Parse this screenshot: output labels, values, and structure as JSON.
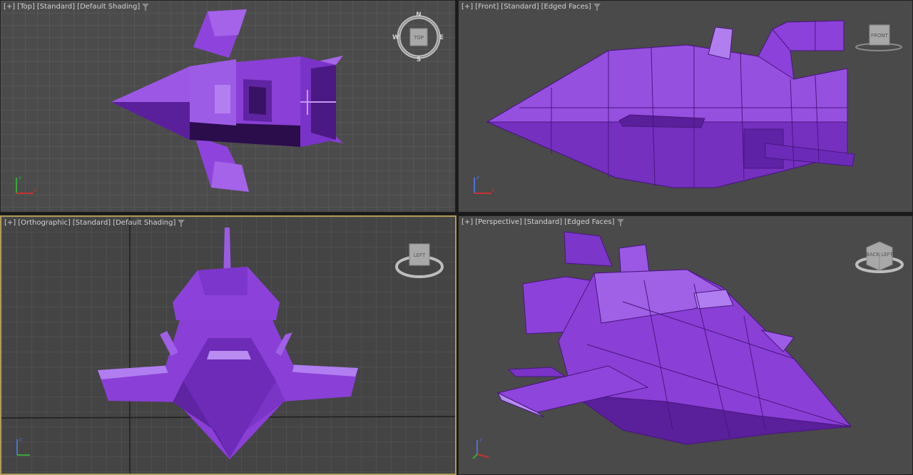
{
  "viewports": {
    "top": {
      "plus": "[+]",
      "view": "[Top]",
      "shading_mode": "[Standard]",
      "display": "[Default Shading]",
      "viewcube_face": "TOP",
      "compass": {
        "n": "N",
        "s": "S",
        "e": "E",
        "w": "W"
      }
    },
    "front": {
      "plus": "[+]",
      "view": "[Front]",
      "shading_mode": "[Standard]",
      "display": "[Edged Faces]",
      "viewcube_face": "FRONT"
    },
    "orthographic": {
      "plus": "[+]",
      "view": "[Orthographic]",
      "shading_mode": "[Standard]",
      "display": "[Default Shading]",
      "viewcube_face": "LEFT",
      "active": true
    },
    "perspective": {
      "plus": "[+]",
      "view": "[Perspective]",
      "shading_mode": "[Standard]",
      "display": "[Edged Faces]",
      "viewcube_face": "BACK LEFT"
    }
  },
  "axis": {
    "x": "x",
    "y": "y",
    "z": "z"
  },
  "colors": {
    "model": "#8a3fd6",
    "model_light": "#a063e6",
    "model_dark": "#4a1880",
    "grid": "#5d5d5d",
    "active_border": "#b09a55"
  }
}
